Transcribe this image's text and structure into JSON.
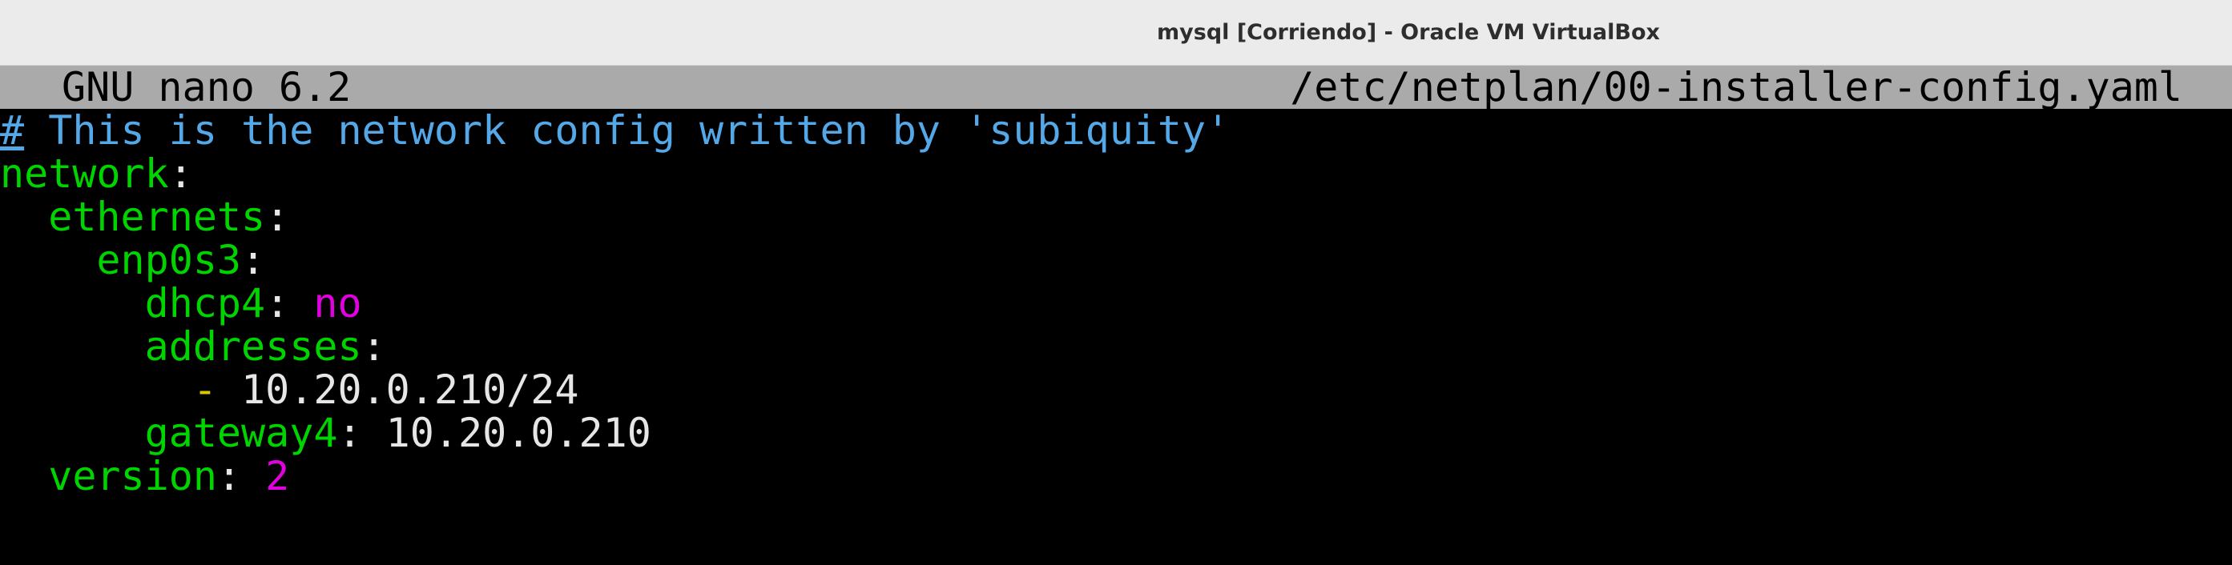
{
  "window": {
    "title": "mysql [Corriendo] - Oracle VM VirtualBox"
  },
  "nano": {
    "app_name": "GNU nano 6.2",
    "file_path": "/etc/netplan/00-installer-config.yaml"
  },
  "editor": {
    "cursor_char": "#",
    "comment_text": " This is the network config written by 'subiquity'",
    "network_key": "network",
    "ethernets_key": "ethernets",
    "interface_key": "enp0s3",
    "dhcp4_key": "dhcp4",
    "dhcp4_value": "no",
    "addresses_key": "addresses",
    "list_dash": "-",
    "address_value": "10.20.0.210/24",
    "gateway4_key": "gateway4",
    "gateway4_value": "10.20.0.210",
    "version_key": "version",
    "version_value": "2",
    "colon": ":"
  },
  "colors": {
    "comment": "#54a8e8",
    "key": "#00d400",
    "literal": "#e000e0",
    "dash": "#d8c800",
    "header_bg": "#aaaaaa"
  }
}
